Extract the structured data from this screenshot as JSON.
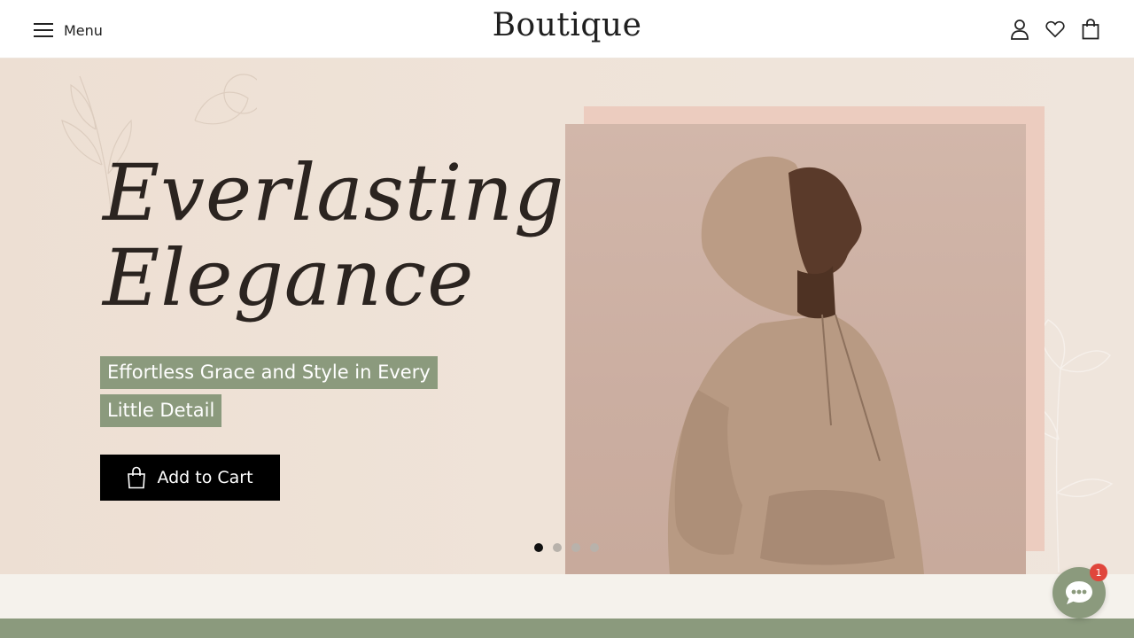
{
  "header": {
    "menu_label": "Menu",
    "brand": "Boutique",
    "icons": [
      "user-icon",
      "heart-icon",
      "shopping-bag-icon"
    ]
  },
  "hero": {
    "title_line1": "Everlasting",
    "title_line2": "Elegance",
    "subtitle_line1": "Effortless Grace and Style in Every",
    "subtitle_line2": "Little Detail",
    "cart_button_label": "Add to Cart",
    "slides_total": 4,
    "slide_active": 1
  },
  "chat": {
    "badge_count": "1"
  },
  "colors": {
    "sage": "#8b9a7d",
    "hero_bg": "#eddfd3",
    "photo_bg": "#cbaea1",
    "badge": "#e0463c"
  }
}
